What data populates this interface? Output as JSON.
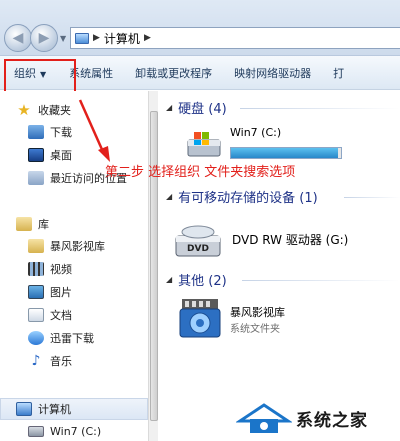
{
  "address_bar": {
    "breadcrumb": "计算机"
  },
  "command_bar": {
    "items": [
      "组织",
      "系统属性",
      "卸载或更改程序",
      "映射网络驱动器",
      "打"
    ]
  },
  "nav_pane": {
    "favorites": {
      "label": "收藏夹",
      "items": [
        "下载",
        "桌面",
        "最近访问的位置"
      ]
    },
    "libraries": {
      "label": "库",
      "items": [
        "暴风影视库",
        "视频",
        "图片",
        "文档",
        "迅雷下载",
        "音乐"
      ]
    },
    "computer": {
      "label": "计算机",
      "items": [
        "Win7 (C:)"
      ]
    }
  },
  "main": {
    "hard_disks": {
      "header": "硬盘 (4)",
      "drive_name": "Win7 (C:)",
      "usage_fraction": 0.97
    },
    "removable": {
      "header": "有可移动存储的设备 (1)",
      "drive_name": "DVD RW 驱动器 (G:)"
    },
    "other": {
      "header": "其他 (2)",
      "name": "暴风影视库",
      "type": "系统文件夹"
    }
  },
  "annotation": {
    "text": "第二步 选择组织 文件夹搜索选项",
    "color": "#e2201b"
  },
  "watermark": {
    "text": "系统之家"
  },
  "colors": {
    "header_blue": "#1e3287",
    "progress_fill": "#2887c9",
    "annotation_red": "#e2201b"
  }
}
